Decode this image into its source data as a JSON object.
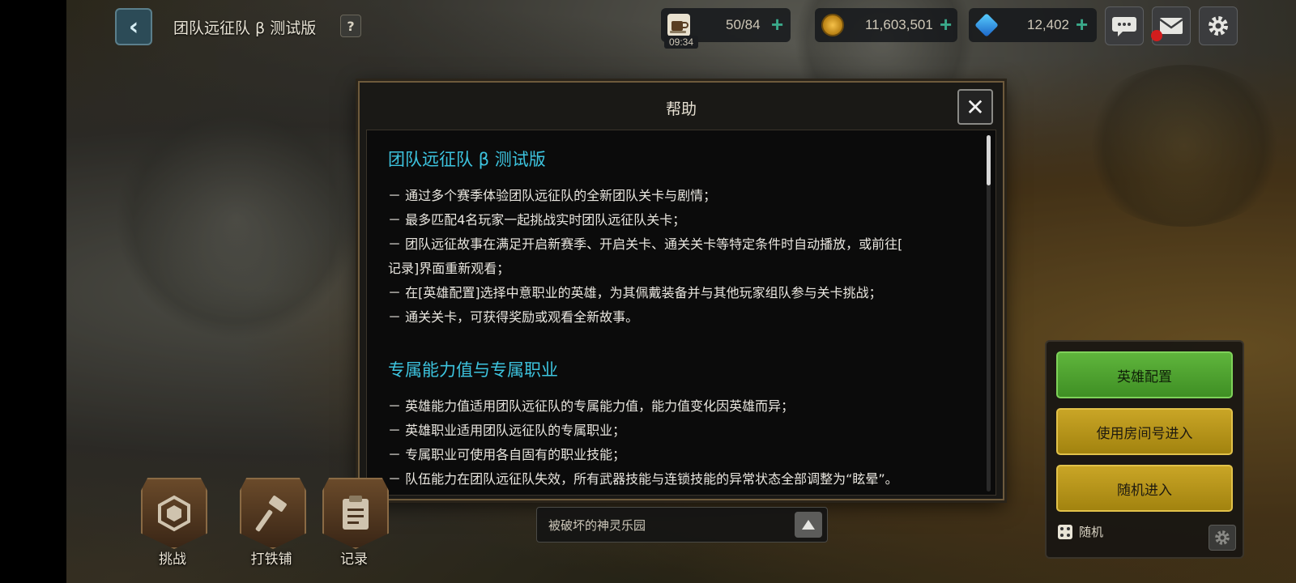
{
  "header": {
    "title": "团队远征队 β 测试版",
    "help_label": "?",
    "back_label": "‹"
  },
  "resources": {
    "stamina": {
      "value": "50/84",
      "timer": "09:34"
    },
    "gold": {
      "value": "11,603,501"
    },
    "gems": {
      "value": "12,402"
    },
    "plus": "+"
  },
  "dialog": {
    "title": "帮助",
    "close_label": "✕",
    "sections": [
      {
        "title": "团队远征队 β 测试版",
        "lines": [
          "－ 通过多个赛季体验团队远征队的全新团队关卡与剧情；",
          "－ 最多匹配4名玩家一起挑战实时团队远征队关卡；",
          "－ 团队远征故事在满足开启新赛季、开启关卡、通关关卡等特定条件时自动播放，或前往[",
          "记录]界面重新观看；",
          "－ 在[英雄配置]选择中意职业的英雄，为其佩戴装备并与其他玩家组队参与关卡挑战；",
          "－ 通关关卡，可获得奖励或观看全新故事。"
        ]
      },
      {
        "title": "专属能力值与专属职业",
        "lines": [
          "－ 英雄能力值适用团队远征队的专属能力值，能力值变化因英雄而异；",
          "－ 英雄职业适用团队远征队的专属职业；",
          "－ 专属职业可使用各自固有的职业技能；",
          "－ 队伍能力在团队远征队失效，所有武器技能与连锁技能的异常状态全部调整为“眩晕”。"
        ]
      }
    ]
  },
  "right_panel": {
    "hero_config": "英雄配置",
    "room_enter": "使用房间号进入",
    "random_enter": "随机进入",
    "random_mode": "随机"
  },
  "bottom_nav": {
    "challenge": "挑战",
    "forge": "打铁铺",
    "record": "记录"
  },
  "stage": {
    "name": "被破坏的神灵乐园"
  },
  "colors": {
    "section_title": "#3dc4df",
    "hero_button": "#4fa330",
    "yellow_button": "#b8951a",
    "plus": "#3aa98a",
    "notification": "#d21d1d"
  },
  "icons": [
    "back-arrow-icon",
    "coffee-cup-icon",
    "gold-coin-icon",
    "diamond-gem-icon",
    "chat-bubble-icon",
    "mail-icon",
    "gear-icon",
    "close-icon",
    "dice-icon",
    "challenge-emblem-icon",
    "hammer-icon",
    "clipboard-icon",
    "triangle-up-icon"
  ]
}
